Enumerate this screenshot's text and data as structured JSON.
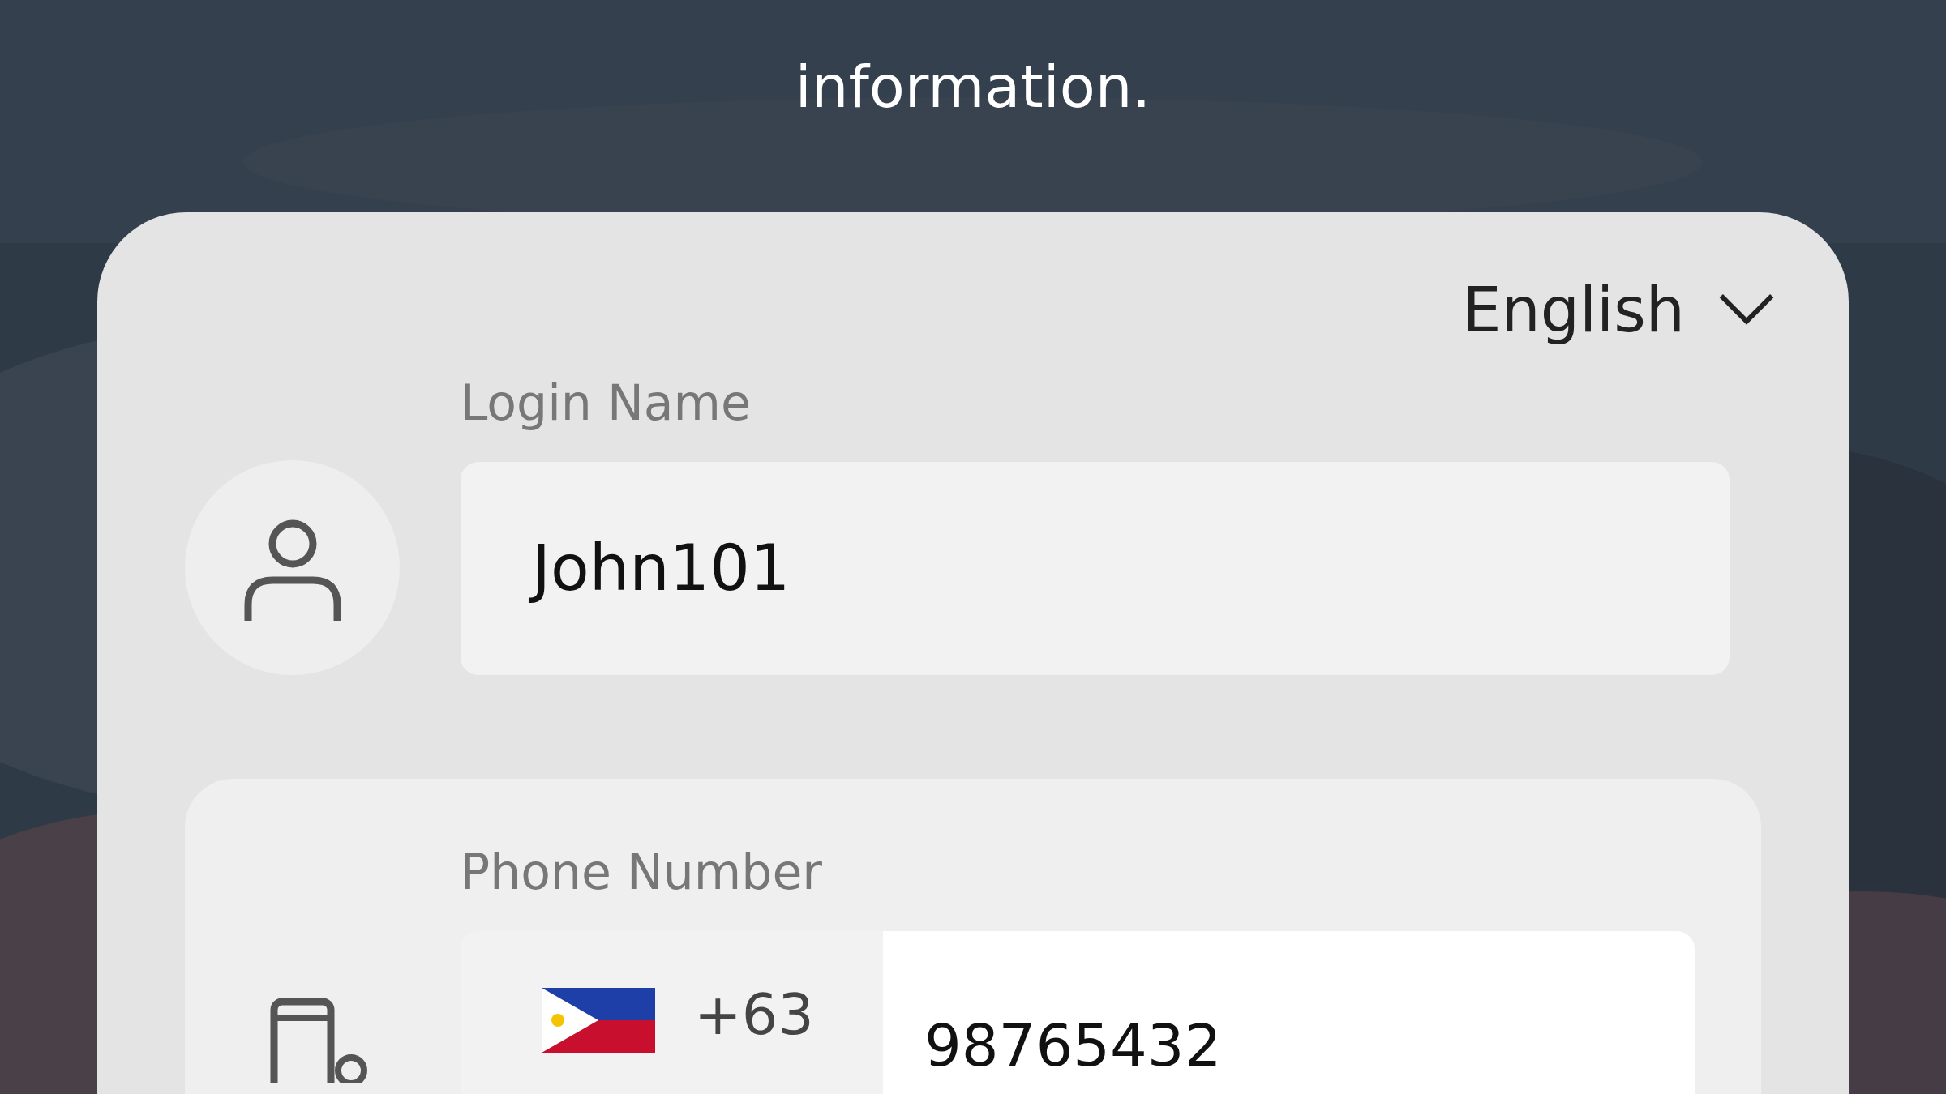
{
  "intro": "information.",
  "language": {
    "label": "English"
  },
  "login_name": {
    "label": "Login Name",
    "value": "John101"
  },
  "phone_number": {
    "label": "Phone Number",
    "country_code": "+63",
    "value": "98765432"
  }
}
